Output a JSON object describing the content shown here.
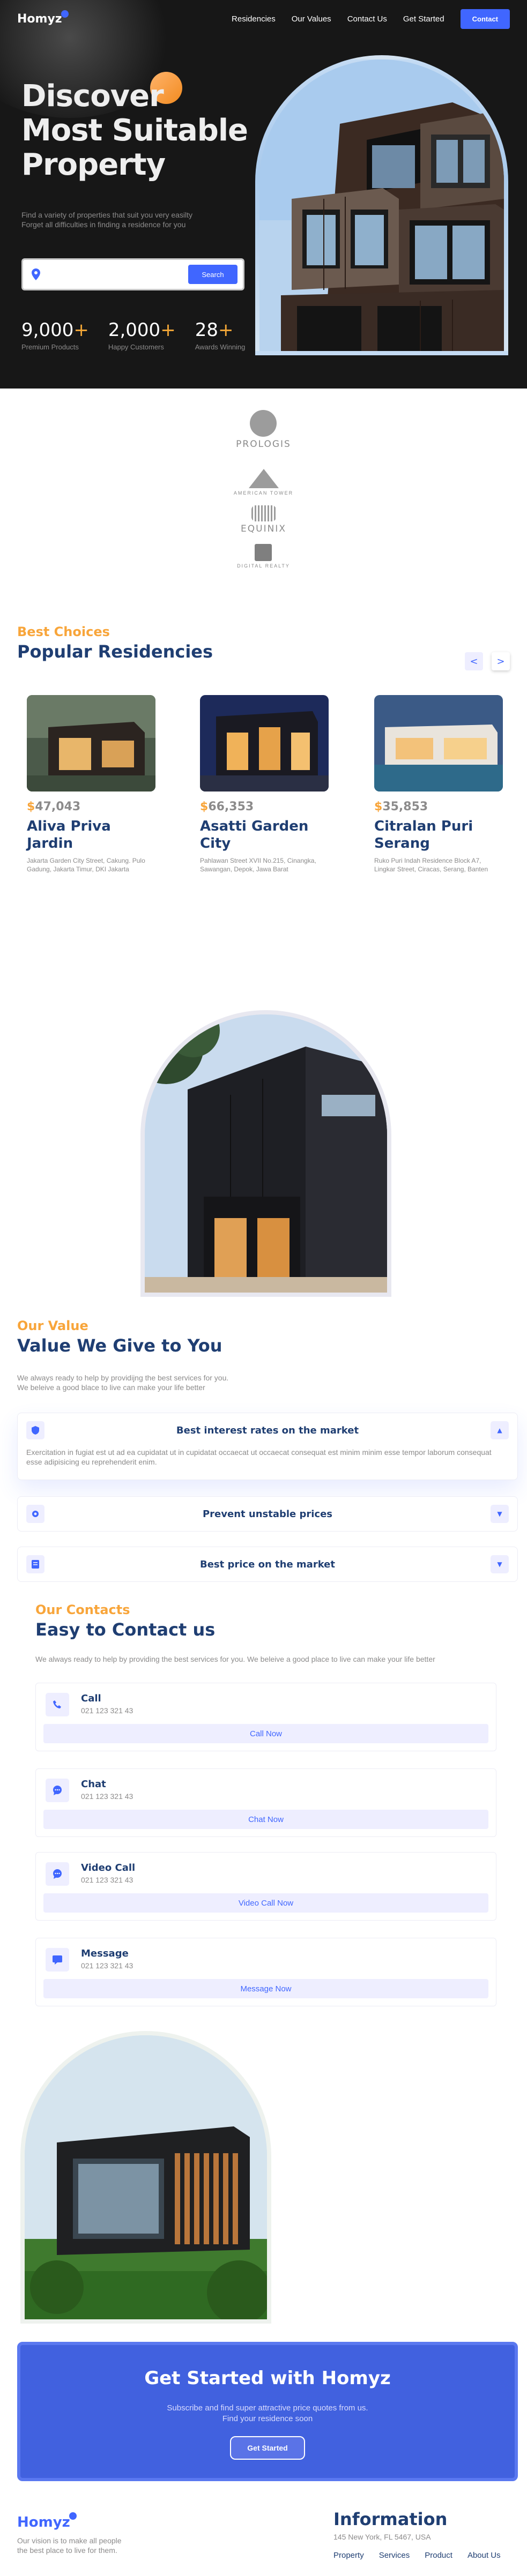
{
  "brand": {
    "name": "Homyz",
    "accent": "#4066ff",
    "orange": "#f8a53a",
    "navy": "#1f3e72"
  },
  "navbar": {
    "links": [
      "Residencies",
      "Our Values",
      "Contact Us",
      "Get Started"
    ],
    "contact_button": "Contact"
  },
  "hero": {
    "title_lines": [
      "Discover",
      "Most Suitable",
      "Property"
    ],
    "subtitle_lines": [
      "Find a variety of properties that suit you very easilty",
      "Forget all difficulties in finding a residence for you"
    ],
    "search": {
      "value": "",
      "placeholder": "",
      "button": "Search",
      "icon": "location-pin-icon"
    },
    "stats": [
      {
        "value": "9,000",
        "suffix": "+",
        "label": "Premium Products"
      },
      {
        "value": "2,000",
        "suffix": "+",
        "label": "Happy Customers"
      },
      {
        "value": "28",
        "suffix": "+",
        "label": "Awards Winning"
      }
    ]
  },
  "companies": [
    {
      "name": "PROLOGIS",
      "icon": "globe-logo-icon"
    },
    {
      "name": "AMERICAN TOWER",
      "icon": "tower-logo-icon"
    },
    {
      "name": "EQUINIX",
      "icon": "equinix-logo-icon"
    },
    {
      "name": "DIGITAL REALTY",
      "icon": "cube-logo-icon"
    }
  ],
  "residencies": {
    "tag": "Best Choices",
    "title": "Popular Residencies",
    "prev": "<",
    "next": ">",
    "cards": [
      {
        "currency": "$",
        "price": "47,043",
        "name": "Aliva Priva Jardin",
        "address": "Jakarta Garden City Street, Cakung. Pulo Gadung, Jakarta Timur, DKI Jakarta"
      },
      {
        "currency": "$",
        "price": "66,353",
        "name": "Asatti Garden City",
        "address": "Pahlawan Street XVII No.215, Cinangka, Sawangan, Depok, Jawa Barat"
      },
      {
        "currency": "$",
        "price": "35,853",
        "name": "Citralan Puri Serang",
        "address": "Ruko Puri Indah Residence Block A7, Lingkar Street, Ciracas, Serang, Banten"
      }
    ]
  },
  "values": {
    "tag": "Our Value",
    "title": "Value We Give to You",
    "description_lines": [
      "We always ready to help by providijng the best services for you.",
      "We beleive a good blace to live can make your life better"
    ],
    "items": [
      {
        "title": "Best interest rates on the market",
        "icon": "shield-icon",
        "toggle": "▲",
        "expanded": true,
        "body": "Exercitation in fugiat est ut ad ea cupidatat ut in cupidatat occaecat ut occaecat consequat est minim minim esse tempor laborum consequat esse adipisicing eu reprehenderit enim."
      },
      {
        "title": "Prevent unstable prices",
        "icon": "gear-icon",
        "toggle": "▼",
        "expanded": false,
        "body": ""
      },
      {
        "title": "Best price on the market",
        "icon": "document-icon",
        "toggle": "▼",
        "expanded": false,
        "body": ""
      }
    ]
  },
  "contacts": {
    "tag": "Our Contacts",
    "title": "Easy to Contact us",
    "description": "We always ready to help by providing the best services for you. We beleive a good place to live can make your life better",
    "items": [
      {
        "title": "Call",
        "number": "021 123 321 43",
        "button": "Call Now",
        "icon": "phone-icon"
      },
      {
        "title": "Chat",
        "number": "021 123 321 43",
        "button": "Chat Now",
        "icon": "chat-icon"
      },
      {
        "title": "Video Call",
        "number": "021 123 321 43",
        "button": "Video Call Now",
        "icon": "video-chat-icon"
      },
      {
        "title": "Message",
        "number": "021 123 321 43",
        "button": "Message Now",
        "icon": "message-icon"
      }
    ]
  },
  "get_started": {
    "title": "Get Started with Homyz",
    "text_lines": [
      "Subscribe and find super attractive price quotes from us.",
      "Find your residence soon"
    ],
    "button": "Get Started"
  },
  "footer": {
    "logo": "Homyz",
    "vision_lines": [
      "Our vision is to make all people",
      "the best place to live for them."
    ],
    "info_title": "Information",
    "address": "145 New York, FL 5467, USA",
    "links": [
      "Property",
      "Services",
      "Product",
      "About Us"
    ]
  }
}
